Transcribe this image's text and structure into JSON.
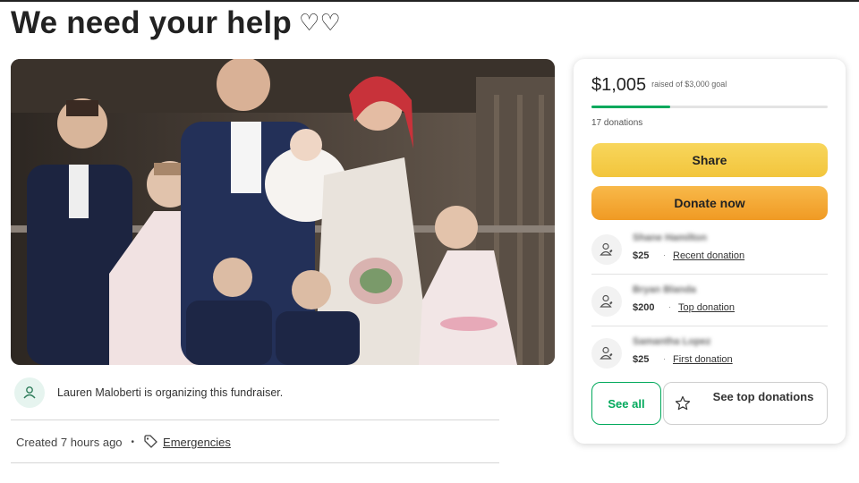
{
  "page": {
    "title": "We need your help",
    "title_suffix": "♡♡"
  },
  "photo": {
    "description_icon": "family-wedding-photo"
  },
  "organizer": {
    "icon": "user-group-icon",
    "text": "Lauren Maloberti is organizing this fundraiser."
  },
  "meta": {
    "created": "Created 7 hours ago",
    "separator": "•",
    "category_icon": "tag-icon",
    "category": "Emergencies"
  },
  "campaign": {
    "raised": "$1,005",
    "goal_text": "raised of $3,000 goal",
    "progress_fraction": 0.335,
    "donations_count": "17 donations",
    "progress_color": "#02a95c",
    "share_label": "Share",
    "donate_label": "Donate now"
  },
  "donors": [
    {
      "name": "Shane Hamilton",
      "amount": "$25",
      "kind": "Recent donation",
      "icon": "donor-heart-icon"
    },
    {
      "name": "Bryan Blanda",
      "amount": "$200",
      "kind": "Top donation",
      "icon": "donor-heart-icon"
    },
    {
      "name": "Samantha Lopez",
      "amount": "$25",
      "kind": "First donation",
      "icon": "donor-heart-icon"
    }
  ],
  "donor_separator": "·",
  "actions": {
    "see_all": "See all",
    "see_top": "See top donations",
    "see_top_icon": "star-icon"
  }
}
